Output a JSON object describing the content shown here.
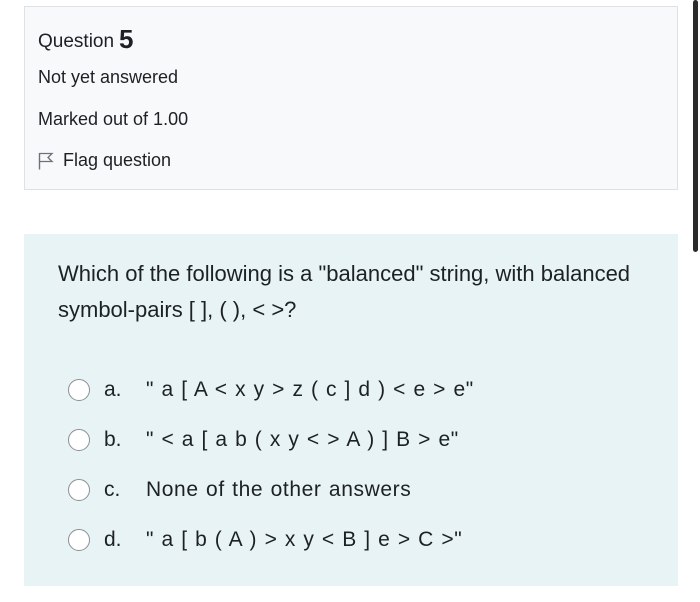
{
  "info": {
    "question_label": "Question",
    "question_number": "5",
    "state": "Not yet answered",
    "grade": "Marked out of 1.00",
    "flag_label": "Flag question"
  },
  "question": {
    "text": "Which of the following is a \"balanced\" string, with balanced symbol-pairs [ ], ( ), < >?",
    "options": [
      {
        "letter": "a.",
        "text": "\" a [ A < x y > z ( c ] d ) < e > e\""
      },
      {
        "letter": "b.",
        "text": "\" < a [ a b ( x y < > A ) ] B > e\""
      },
      {
        "letter": "c.",
        "text": "None of the other answers"
      },
      {
        "letter": "d.",
        "text": "\" a [ b ( A ) > x y < B ] e > C >\""
      }
    ]
  }
}
